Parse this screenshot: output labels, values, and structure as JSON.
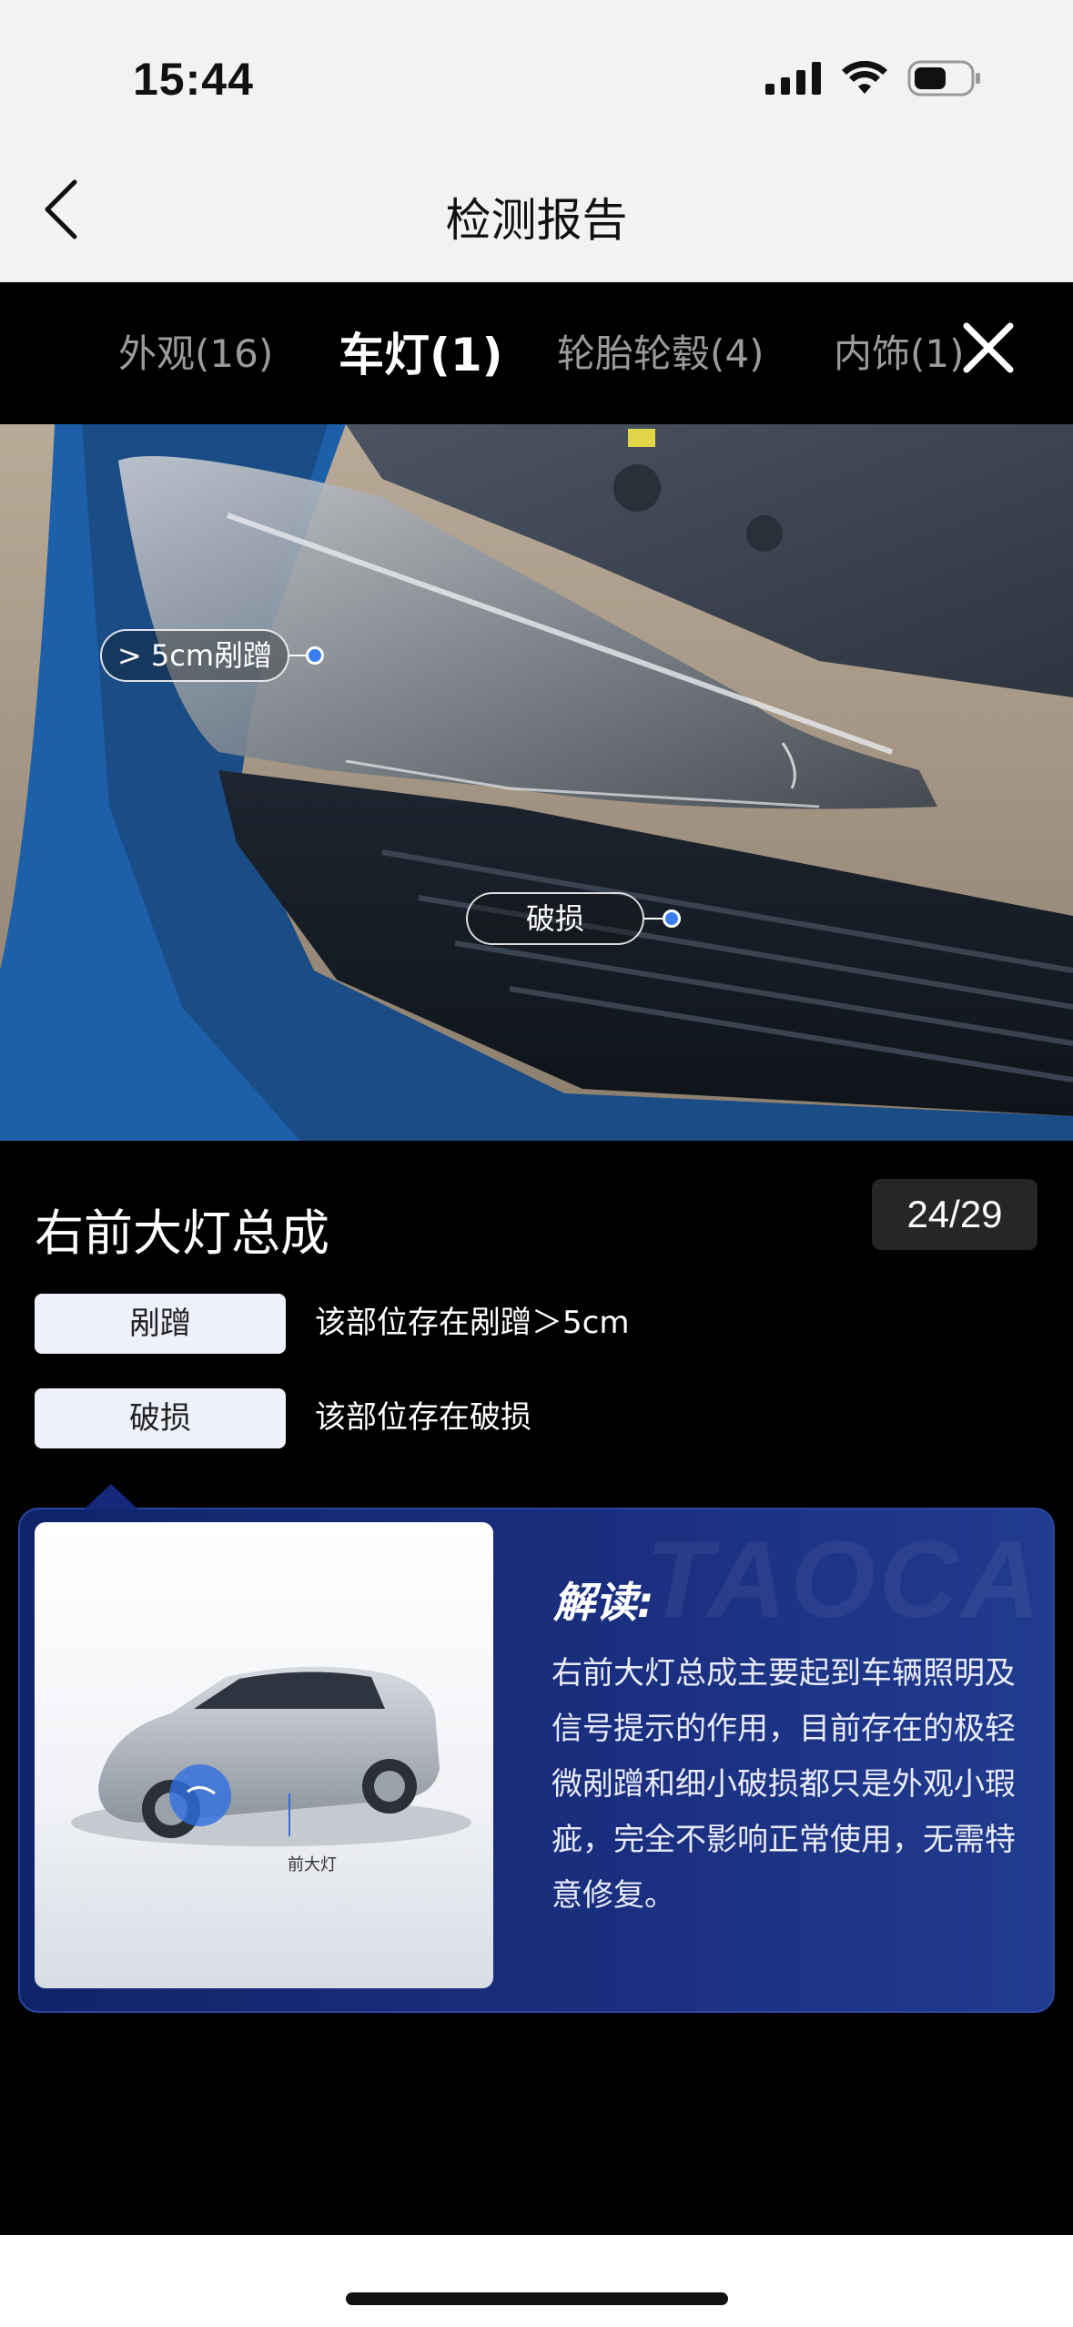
{
  "status": {
    "time": "15:44",
    "icons": [
      "signal-icon",
      "wifi-icon",
      "battery-icon"
    ]
  },
  "nav": {
    "title": "检测报告",
    "back_icon": "chevron-left-icon"
  },
  "tabs": [
    {
      "label": "外观(16)",
      "active": false
    },
    {
      "label": "车灯(1)",
      "active": true
    },
    {
      "label": "轮胎轮毂(4)",
      "active": false
    },
    {
      "label": "内饰(1)",
      "active": false
    }
  ],
  "close_icon": "close-icon",
  "photo_tags": [
    {
      "label": "> 5cm剐蹭"
    },
    {
      "label": "破损"
    }
  ],
  "part": {
    "title": "右前大灯总成",
    "page_indicator": "24/29"
  },
  "defects": [
    {
      "chip": "剐蹭",
      "description": "该部位存在剐蹭＞5cm"
    },
    {
      "chip": "破损",
      "description": "该部位存在破损"
    }
  ],
  "interpretation": {
    "heading": "解读:",
    "body": "右前大灯总成主要起到车辆照明及信号提示的作用，目前存在的极轻微剐蹭和细小破损都只是外观小瑕疵，完全不影响正常使用，无需特意修复。",
    "car_caption": "前大灯",
    "watermark": "TAOCA"
  },
  "colors": {
    "accent_blue": "#3b7df0",
    "card_bg": "#1b2f80",
    "chip_bg": "#eef0fb"
  }
}
